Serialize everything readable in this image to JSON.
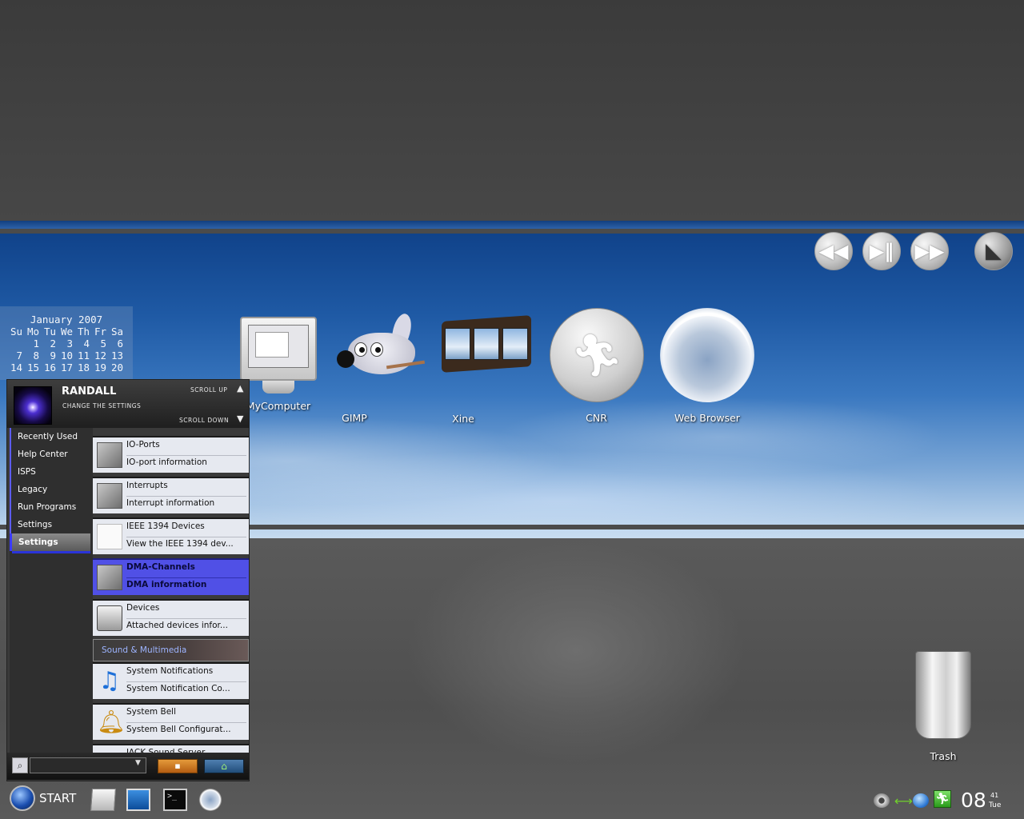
{
  "calendar": {
    "title": "January 2007",
    "weekdays": [
      "Su",
      "Mo",
      "Tu",
      "We",
      "Th",
      "Fr",
      "Sa"
    ],
    "weeks": [
      [
        "",
        "1",
        "2",
        "3",
        "4",
        "5",
        "6"
      ],
      [
        "7",
        "8",
        "9",
        "10",
        "11",
        "12",
        "13"
      ],
      [
        "14",
        "15",
        "16",
        "17",
        "18",
        "19",
        "20"
      ]
    ]
  },
  "media": {
    "rewind_icon": "rewind-icon",
    "play_pause_icon": "play-pause-icon",
    "forward_icon": "fast-forward-icon",
    "wolf_icon": "wolf-icon"
  },
  "desktop_icons": {
    "mycomputer": "MyComputer",
    "gimp": "GIMP",
    "xine": "Xine",
    "cnr": "CNR",
    "web_browser": "Web Browser",
    "trash": "Trash"
  },
  "menu": {
    "user_name": "RANDALL",
    "subtitle": "CHANGE THE SETTINGS",
    "scroll_up": "SCROLL UP",
    "scroll_down": "SCROLL DOWN",
    "categories": [
      "Recently Used",
      "Help Center",
      "ISPS",
      "Legacy",
      "Run Programs",
      "Settings",
      "Settings"
    ],
    "items": [
      {
        "title": "IO-Ports",
        "desc": "IO-port information"
      },
      {
        "title": "Interrupts",
        "desc": "Interrupt information"
      },
      {
        "title": "IEEE 1394 Devices",
        "desc": "View the IEEE 1394 dev..."
      },
      {
        "title": "DMA-Channels",
        "desc": "DMA information"
      },
      {
        "title": "Devices",
        "desc": "Attached devices infor..."
      },
      {
        "title": "System Notifications",
        "desc": "System Notification Co..."
      },
      {
        "title": "System Bell",
        "desc": "System Bell Configurat..."
      },
      {
        "title": "JACK Sound Server",
        "desc": ""
      }
    ],
    "section_label": "Sound & Multimedia",
    "search_placeholder": ""
  },
  "taskbar": {
    "start_label": "START",
    "clock_hour": "08",
    "clock_minute": "41",
    "clock_day": "Tue"
  }
}
